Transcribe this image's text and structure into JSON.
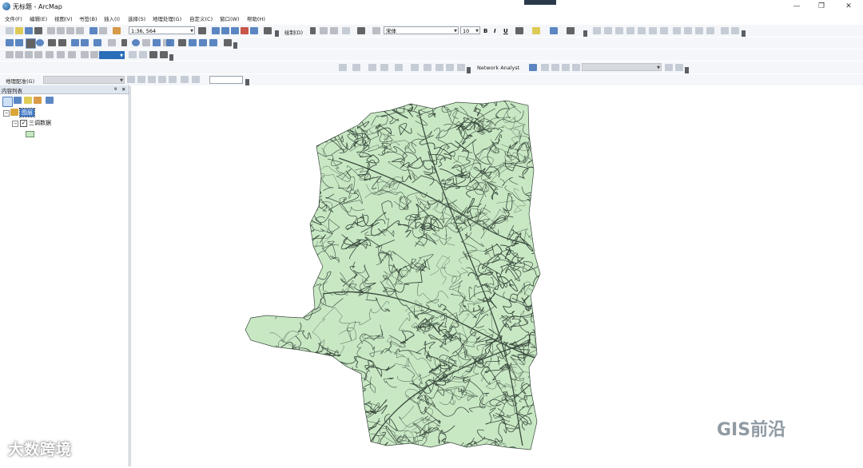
{
  "window": {
    "title": "无标题 - ArcMap",
    "controls": [
      "—",
      "❐",
      "✕"
    ]
  },
  "menu": [
    "文件(F)",
    "编辑(E)",
    "视图(V)",
    "书签(B)",
    "插入(I)",
    "选择(S)",
    "地理处理(G)",
    "自定义(C)",
    "窗口(W)",
    "帮助(H)"
  ],
  "toolbar_standard": {
    "scale": "1:36, 564"
  },
  "toolbar_draw": {
    "label": "绘制(D)",
    "font": "宋体",
    "font_size": "10",
    "bold": "B",
    "italic": "I",
    "underline": "U"
  },
  "toolbar_network": {
    "label": "Network Analyst"
  },
  "toolbar_georef": {
    "label": "地理配准(G)"
  },
  "toc": {
    "title": "内容列表",
    "pin": "ª",
    "close": "✕",
    "layers_root": "图层",
    "layer_name": "三调数据"
  },
  "map": {
    "fill_color": "#c8e8c4",
    "line_color": "#3a4a3e"
  },
  "watermarks": {
    "left": "大数跨境",
    "right": "GIS前沿"
  }
}
